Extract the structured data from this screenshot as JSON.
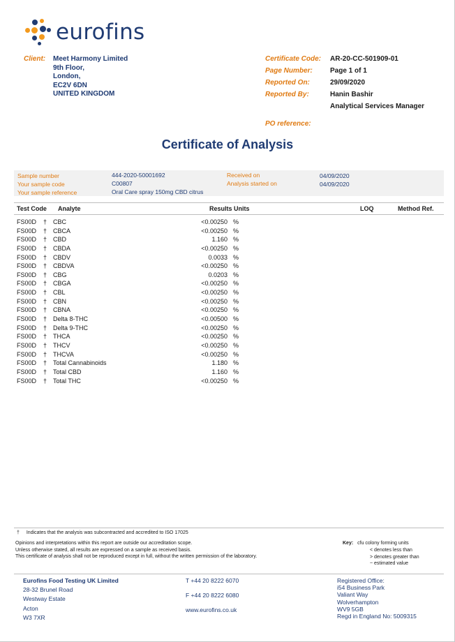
{
  "logo": {
    "text": "eurofins"
  },
  "client": {
    "label": "Client:",
    "lines": [
      "Meet Harmony Limited",
      "9th Floor,",
      "London,",
      "EC2V 6DN",
      "UNITED KINGDOM"
    ]
  },
  "meta": {
    "certificate_code_label": "Certificate Code:",
    "certificate_code": "AR-20-CC-501909-01",
    "page_number_label": "Page Number:",
    "page_number": "Page 1 of 1",
    "reported_on_label": "Reported On:",
    "reported_on": "29/09/2020",
    "reported_by_label": "Reported By:",
    "reported_by_name": "Hanin Bashir",
    "reported_by_title": "Analytical Services Manager",
    "po_reference_label": "PO reference:"
  },
  "title": "Certificate of Analysis",
  "sample": {
    "sample_number_label": "Sample number",
    "sample_number": "444-2020-50001692",
    "sample_code_label": "Your sample code",
    "sample_code": "C00807",
    "sample_reference_label": "Your sample reference",
    "sample_reference": "Oral Care spray 150mg CBD citrus",
    "received_on_label": "Received on",
    "received_on": "04/09/2020",
    "analysis_started_label": "Analysis started on",
    "analysis_started": "04/09/2020"
  },
  "table": {
    "headers": {
      "test_code": "Test Code",
      "analyte": "Analyte",
      "results_units": "Results Units",
      "loq": "LOQ",
      "method_ref": "Method Ref."
    },
    "rows": [
      {
        "code": "FS00D",
        "mark": "†",
        "analyte": "CBC",
        "result": "<0.00250",
        "unit": "%"
      },
      {
        "code": "FS00D",
        "mark": "†",
        "analyte": "CBCA",
        "result": "<0.00250",
        "unit": "%"
      },
      {
        "code": "FS00D",
        "mark": "†",
        "analyte": "CBD",
        "result": "1.160",
        "unit": "%"
      },
      {
        "code": "FS00D",
        "mark": "†",
        "analyte": "CBDA",
        "result": "<0.00250",
        "unit": "%"
      },
      {
        "code": "FS00D",
        "mark": "†",
        "analyte": "CBDV",
        "result": "0.0033",
        "unit": "%"
      },
      {
        "code": "FS00D",
        "mark": "†",
        "analyte": "CBDVA",
        "result": "<0.00250",
        "unit": "%"
      },
      {
        "code": "FS00D",
        "mark": "†",
        "analyte": "CBG",
        "result": "0.0203",
        "unit": "%"
      },
      {
        "code": "FS00D",
        "mark": "†",
        "analyte": "CBGA",
        "result": "<0.00250",
        "unit": "%"
      },
      {
        "code": "FS00D",
        "mark": "†",
        "analyte": "CBL",
        "result": "<0.00250",
        "unit": "%"
      },
      {
        "code": "FS00D",
        "mark": "†",
        "analyte": "CBN",
        "result": "<0.00250",
        "unit": "%"
      },
      {
        "code": "FS00D",
        "mark": "†",
        "analyte": "CBNA",
        "result": "<0.00250",
        "unit": "%"
      },
      {
        "code": "FS00D",
        "mark": "†",
        "analyte": "Delta 8-THC",
        "result": "<0.00500",
        "unit": "%"
      },
      {
        "code": "FS00D",
        "mark": "†",
        "analyte": "Delta 9-THC",
        "result": "<0.00250",
        "unit": "%"
      },
      {
        "code": "FS00D",
        "mark": "†",
        "analyte": "THCA",
        "result": "<0.00250",
        "unit": "%"
      },
      {
        "code": "FS00D",
        "mark": "†",
        "analyte": "THCV",
        "result": "<0.00250",
        "unit": "%"
      },
      {
        "code": "FS00D",
        "mark": "†",
        "analyte": "THCVA",
        "result": "<0.00250",
        "unit": "%"
      },
      {
        "code": "FS00D",
        "mark": "†",
        "analyte": "Total Cannabinoids",
        "result": "1.180",
        "unit": "%"
      },
      {
        "code": "FS00D",
        "mark": "†",
        "analyte": "Total CBD",
        "result": "1.160",
        "unit": "%"
      },
      {
        "code": "FS00D",
        "mark": "†",
        "analyte": "Total THC",
        "result": "<0.00250",
        "unit": "%"
      }
    ]
  },
  "footnote": {
    "mark": "†",
    "text": "Indicates that the analysis was subcontracted and accredited to ISO 17025"
  },
  "disclaimer": [
    "Opinions and interpretations within this report are outside our accreditation scope.",
    "Unless otherwise stated, all results are expressed on a sample as received basis.",
    "This certificate of analysis shall not be reproduced except in full, without the written permission of the laboratory."
  ],
  "key": {
    "label": "Key:",
    "items": [
      "cfu colony forming units",
      "< denotes less than",
      "> denotes greater than",
      "~ estimated value"
    ]
  },
  "footer": {
    "company": "Eurofins Food Testing UK Limited",
    "address": [
      "28-32 Brunel Road",
      "Westway Estate",
      "Acton",
      "W3 7XR"
    ],
    "telephone": "T  +44 20 8222 6070",
    "fax": "F  +44 20 8222 6080",
    "website": "www.eurofins.co.uk",
    "registered": [
      "Registered Office:",
      "i54 Business Park",
      "Valiant Way",
      "Wolverhampton",
      "WV9 5GB",
      "Regd in England No: 5009315"
    ]
  },
  "colors": {
    "brand_navy": "#1f3b73",
    "accent_orange": "#e07b13",
    "sample_box_bg": "#f1f1f1"
  }
}
